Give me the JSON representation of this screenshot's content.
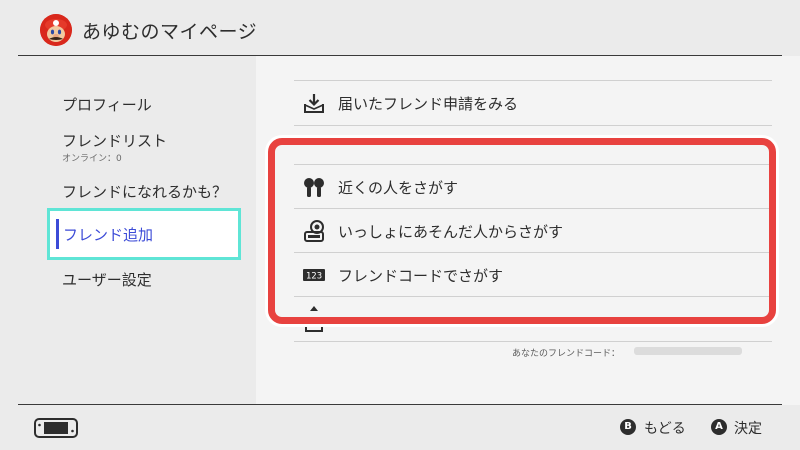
{
  "header": {
    "title": "あゆむのマイページ",
    "avatar_icon": "mario-avatar-icon"
  },
  "sidebar": {
    "items": [
      {
        "label": "プロフィール"
      },
      {
        "label": "フレンドリスト",
        "sub": "オンライン：0"
      },
      {
        "label": "フレンドになれるかも？"
      },
      {
        "label": "フレンド追加",
        "selected": true
      },
      {
        "label": "ユーザー設定"
      }
    ]
  },
  "main": {
    "rows": [
      {
        "label": "届いたフレンド申請をみる",
        "icon": "inbox-download-icon"
      },
      {
        "label": "近くの人をさがす",
        "icon": "nearby-people-icon"
      },
      {
        "label": "いっしょにあそんだ人からさがす",
        "icon": "played-with-icon"
      },
      {
        "label": "フレンドコードでさがす",
        "icon": "friend-code-icon"
      }
    ],
    "friend_code_label": "あなたのフレンドコード："
  },
  "footer": {
    "back": {
      "button": "B",
      "label": "もどる"
    },
    "ok": {
      "button": "A",
      "label": "決定"
    }
  },
  "colors": {
    "highlight": "#e8423f",
    "selection_border": "#5fe5d6",
    "accent": "#3c4bd7"
  }
}
